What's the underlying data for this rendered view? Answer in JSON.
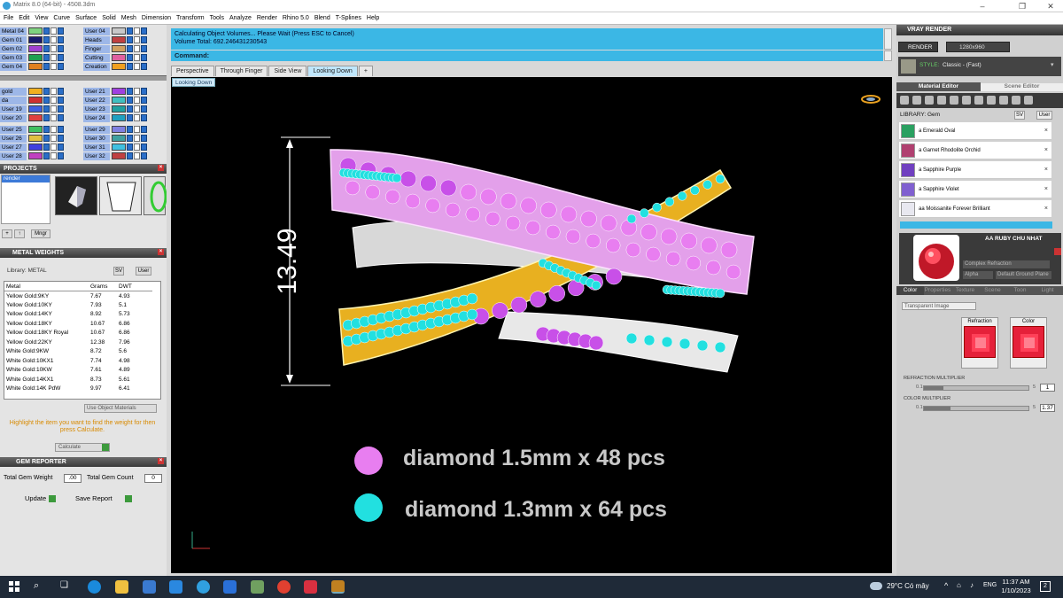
{
  "titlebar": {
    "title": "Matrix 8.0 (64-bit) - 4508.3dm",
    "min": "–",
    "max": "❐",
    "close": "✕"
  },
  "menu": [
    "File",
    "Edit",
    "View",
    "Curve",
    "Surface",
    "Solid",
    "Mesh",
    "Dimension",
    "Transform",
    "Tools",
    "Analyze",
    "Render",
    "Rhino 5.0",
    "Blend",
    "T-Splines",
    "Help"
  ],
  "layers_left": [
    {
      "name": "Metal 04",
      "color": "#7fd27f"
    },
    {
      "name": "Gem 01",
      "color": "#1a1a6e"
    },
    {
      "name": "Gem 02",
      "color": "#a040d0"
    },
    {
      "name": "Gem 03",
      "color": "#20a050"
    },
    {
      "name": "Gem 04",
      "color": "#e08020"
    },
    {
      "name": "gold",
      "color": "#f0b020"
    },
    {
      "name": "da",
      "color": "#d03030"
    },
    {
      "name": "User 19",
      "color": "#4060e0"
    },
    {
      "name": "User 20",
      "color": "#e04040"
    },
    {
      "name": "User 25",
      "color": "#40c060"
    },
    {
      "name": "User 26",
      "color": "#e0c040"
    },
    {
      "name": "User 27",
      "color": "#4040e0"
    },
    {
      "name": "User 28",
      "color": "#c040c0"
    }
  ],
  "layers_right": [
    {
      "name": "User 04",
      "color": "#c8c8c8"
    },
    {
      "name": "Heads",
      "color": "#c04040"
    },
    {
      "name": "Finger",
      "color": "#d0a060"
    },
    {
      "name": "Cutting",
      "color": "#e060a0"
    },
    {
      "name": "Creation",
      "color": "#f0a020"
    },
    {
      "name": "User 21",
      "color": "#a040e0"
    },
    {
      "name": "User 22",
      "color": "#40c0c0"
    },
    {
      "name": "User 23",
      "color": "#20a0a0"
    },
    {
      "name": "User 24",
      "color": "#20a0c0"
    },
    {
      "name": "User 29",
      "color": "#8080e0"
    },
    {
      "name": "User 30",
      "color": "#40a0a0"
    },
    {
      "name": "User 31",
      "color": "#40c0e0"
    },
    {
      "name": "User 32",
      "color": "#c04040"
    }
  ],
  "projects": {
    "header": "PROJECTS",
    "item": "render",
    "mngr": "Mngr"
  },
  "metal_weights": {
    "header": "METAL WEIGHTS",
    "library_label": "Library: METAL",
    "lib_btn": "SV",
    "user_btn": "User",
    "columns": [
      "Metal",
      "Grams",
      "DWT"
    ],
    "rows": [
      [
        "Yellow Gold:9KY",
        "7.67",
        "4.93"
      ],
      [
        "Yellow Gold:10KY",
        "7.93",
        "5.1"
      ],
      [
        "Yellow Gold:14KY",
        "8.92",
        "5.73"
      ],
      [
        "Yellow Gold:18KY",
        "10.67",
        "6.86"
      ],
      [
        "Yellow Gold:18KY Royal",
        "10.67",
        "6.86"
      ],
      [
        "Yellow Gold:22KY",
        "12.38",
        "7.96"
      ],
      [
        "White Gold:9KW",
        "8.72",
        "5.6"
      ],
      [
        "White Gold:10KX1",
        "7.74",
        "4.98"
      ],
      [
        "White Gold:10KW",
        "7.61",
        "4.89"
      ],
      [
        "White Gold:14KX1",
        "8.73",
        "5.61"
      ],
      [
        "White Gold:14K PdW",
        "9.97",
        "6.41"
      ]
    ],
    "use_object": "Use Object Materials",
    "hint": "Highlight the item you want to find the weight for then press Calculate.",
    "calculate": "Calculate"
  },
  "gem_reporter": {
    "header": "GEM REPORTER",
    "total_weight_label": "Total Gem Weight",
    "total_weight": ".00",
    "total_count_label": "Total Gem Count",
    "total_count": "0",
    "update": "Update",
    "save_report": "Save Report"
  },
  "command": {
    "history1": "Calculating Object Volumes... Please Wait (Press ESC to Cancel)",
    "history2": "Volume Total: 692.246431230543",
    "prompt": "Command:"
  },
  "viewport_tabs": [
    "Perspective",
    "Through Finger",
    "Side View",
    "Looking Down",
    "+"
  ],
  "active_view": "Looking Down",
  "viewport": {
    "dimension": "13.49",
    "legend": [
      {
        "label": "diamond 1.5mm x 48 pcs",
        "color": "#e87ef0"
      },
      {
        "label": "diamond 1.3mm x 64 pcs",
        "color": "#22e0e0"
      }
    ]
  },
  "vray": {
    "header": "VRAY RENDER",
    "render_btn": "RENDER",
    "resolution": "1280x960",
    "style_label": "STYLE:",
    "style_value": "Classic - (Fast)",
    "tabs": [
      "Material Editor",
      "Scene Editor"
    ],
    "library_label": "LIBRARY: Gem",
    "lib_btn": "SV",
    "user_btn": "User",
    "materials": [
      {
        "name": "a Emerald Oval",
        "color": "#2aa060"
      },
      {
        "name": "a Garnet Rhodolite Orchid",
        "color": "#b04070"
      },
      {
        "name": "a Sapphire Purple",
        "color": "#7040c0"
      },
      {
        "name": "a Sapphire Violet",
        "color": "#8060d0"
      },
      {
        "name": "aa Moissanite Forever Brilliant",
        "color": "#e8e8f0"
      }
    ],
    "selected_material": "AA RUBY CHU NHAT",
    "mat_type": "Complex Refraction",
    "alpha_label": "Alpha",
    "ground_plane": "Default Ground Plane",
    "sub_tabs": [
      "Color",
      "Properties",
      "Texture",
      "Scene",
      "Toon",
      "Light"
    ],
    "transparent_label": "Transparent Image",
    "refraction_label": "Refraction",
    "color_label": "Color",
    "refr_mult_label": "REFRACTION MULTIPLIER",
    "refr_min": "0.1",
    "refr_max": "5",
    "refr_value": "1",
    "color_mult_label": "COLOR MULTIPLIER",
    "color_min": "0.1",
    "color_max": "5",
    "color_value": "1.37",
    "refr_level": 0.19,
    "color_level": 0.25
  },
  "taskbar": {
    "weather": "29°C  Có mây",
    "lang": "ENG",
    "time": "11:37 AM",
    "date": "1/10/2023",
    "notif": "2"
  }
}
